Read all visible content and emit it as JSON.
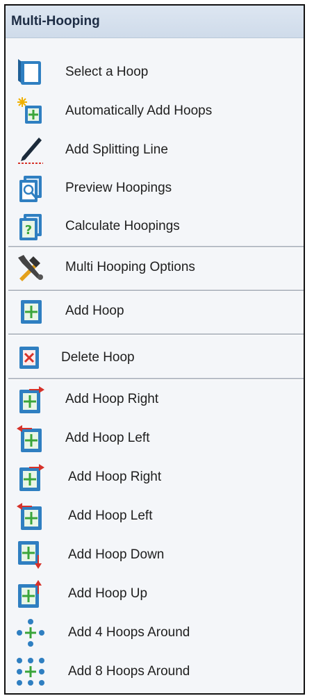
{
  "panel": {
    "title": "Multi-Hooping"
  },
  "items": [
    {
      "label": "Select a Hoop",
      "icon": "select-hoop-icon"
    },
    {
      "label": "Automatically Add Hoops",
      "icon": "auto-add-hoops-icon"
    },
    {
      "label": "Add Splitting Line",
      "icon": "splitting-line-icon"
    },
    {
      "label": "Preview Hoopings",
      "icon": "preview-hoopings-icon"
    },
    {
      "label": "Calculate Hoopings",
      "icon": "calculate-hoopings-icon"
    },
    {
      "label": "Multi Hooping Options",
      "icon": "options-tools-icon"
    },
    {
      "label": "Add Hoop",
      "icon": "add-hoop-icon"
    },
    {
      "label": "Delete Hoop",
      "icon": "delete-hoop-icon"
    },
    {
      "label": "Add Hoop Right",
      "icon": "add-hoop-right-icon"
    },
    {
      "label": "Add Hoop Left",
      "icon": "add-hoop-left-icon"
    },
    {
      "label": "Add Hoop Right",
      "icon": "add-hoop-right-icon"
    },
    {
      "label": "Add Hoop Left",
      "icon": "add-hoop-left-icon"
    },
    {
      "label": "Add Hoop Down",
      "icon": "add-hoop-down-icon"
    },
    {
      "label": "Add Hoop Up",
      "icon": "add-hoop-up-icon"
    },
    {
      "label": "Add 4 Hoops Around",
      "icon": "add-4-hoops-around-icon"
    },
    {
      "label": "Add 8 Hoops Around",
      "icon": "add-8-hoops-around-icon"
    }
  ],
  "colors": {
    "hoop_blue": "#2f7fc1",
    "plus_green": "#3aa53a",
    "arrow_red": "#d6322a"
  }
}
